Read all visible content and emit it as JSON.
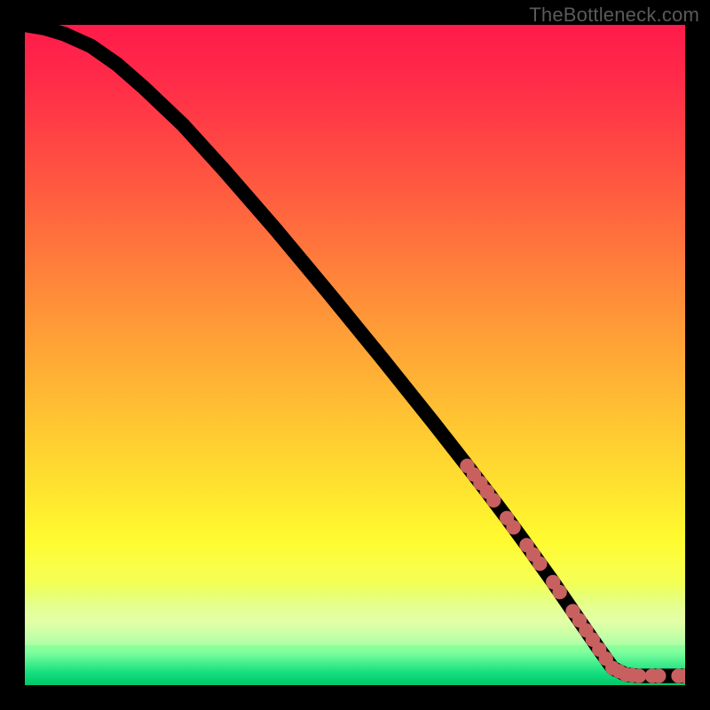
{
  "watermark": {
    "text": "TheBottleneck.com"
  },
  "colors": {
    "curve_stroke": "#000000",
    "highlight_fill": "#c8605f",
    "background": "#000000"
  },
  "chart_data": {
    "type": "line",
    "title": "",
    "xlabel": "",
    "ylabel": "",
    "xlim": [
      0,
      100
    ],
    "ylim": [
      0,
      100
    ],
    "grid": false,
    "legend": false,
    "series": [
      {
        "name": "curve",
        "x": [
          0,
          3,
          6,
          10,
          14,
          18,
          24,
          30,
          38,
          46,
          54,
          62,
          67,
          70,
          73,
          76,
          78,
          80,
          83,
          85,
          87,
          89,
          91,
          93,
          95,
          97,
          99,
          100
        ],
        "y": [
          100,
          99.5,
          98.6,
          96.8,
          94.0,
          90.5,
          84.8,
          78.2,
          69.0,
          59.4,
          49.6,
          39.6,
          33.2,
          29.3,
          25.3,
          21.2,
          18.4,
          15.6,
          11.2,
          8.3,
          5.4,
          2.6,
          1.6,
          1.4,
          1.4,
          1.4,
          1.4,
          1.4
        ]
      }
    ],
    "highlight_points": {
      "series": "curve",
      "x": [
        67,
        68,
        69,
        70,
        71,
        73,
        74,
        76,
        77,
        78,
        80,
        81,
        83,
        84,
        85,
        86,
        87,
        88,
        89,
        90,
        91,
        92,
        93,
        95,
        96,
        99,
        100
      ],
      "y": [
        33.2,
        31.9,
        30.6,
        29.3,
        28.0,
        25.3,
        23.9,
        21.2,
        19.8,
        18.4,
        15.6,
        14.1,
        11.2,
        9.8,
        8.3,
        6.9,
        5.4,
        4.0,
        2.6,
        2.1,
        1.6,
        1.5,
        1.4,
        1.4,
        1.4,
        1.4,
        1.4
      ]
    }
  }
}
